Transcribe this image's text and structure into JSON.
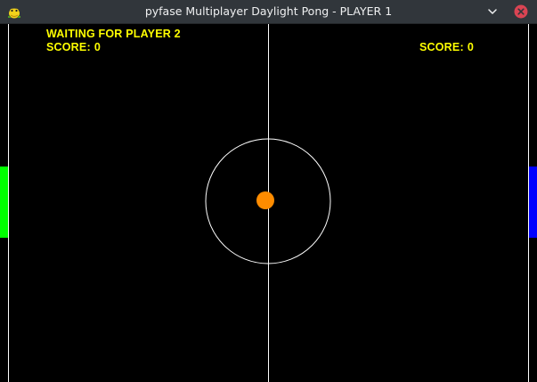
{
  "window": {
    "title": "pyfase Multiplayer Daylight Pong - PLAYER 1",
    "icon": "pygame-snake-icon",
    "controls": [
      "minimize-icon",
      "close-icon"
    ]
  },
  "hud": {
    "status": "WAITING FOR PLAYER 2",
    "score_label": "SCORE:",
    "player1_score": "0",
    "player2_score": "0"
  },
  "colors": {
    "background": "#000000",
    "court_lines": "#ffffff",
    "hud_text": "#ffff00",
    "paddle_left": "#00ff00",
    "paddle_right": "#0000ff",
    "ball": "#ff8c00"
  }
}
